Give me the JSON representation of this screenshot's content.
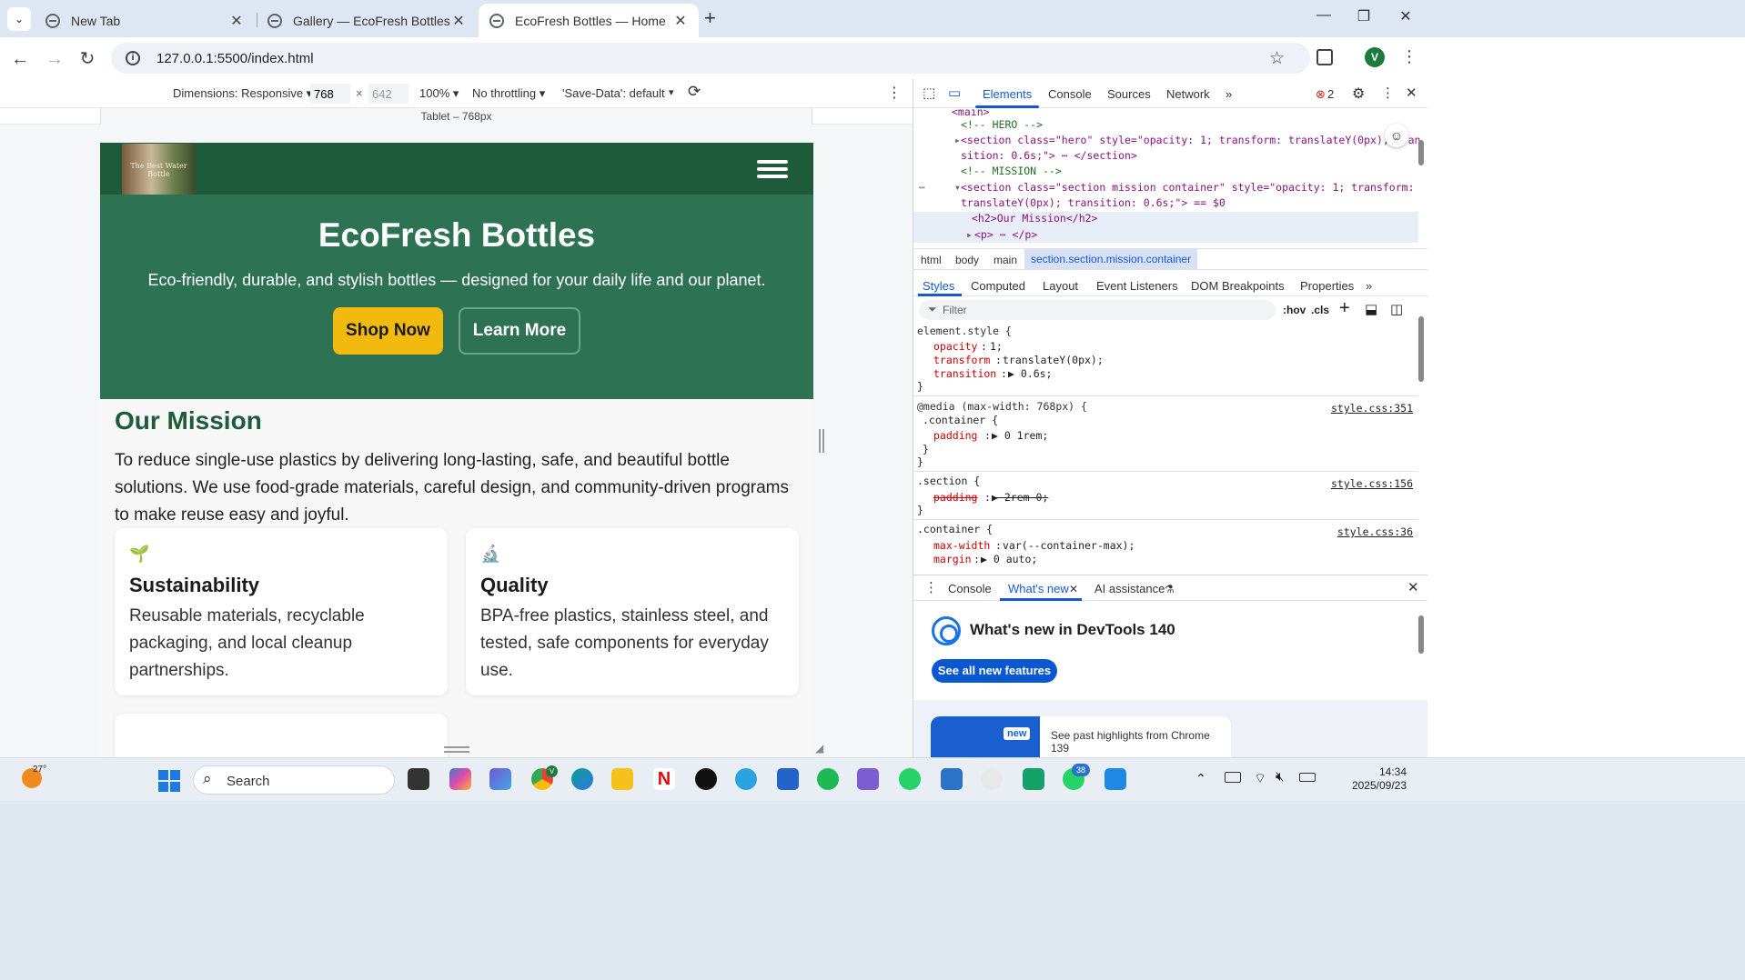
{
  "browser": {
    "tabs": [
      {
        "title": "New Tab"
      },
      {
        "title": "Gallery — EcoFresh Bottles"
      },
      {
        "title": "EcoFresh Bottles — Home"
      }
    ],
    "new_tab_symbol": "+",
    "url": "127.0.0.1:5500/index.html",
    "profile_initial": "V",
    "window_controls": {
      "minimize": "—",
      "restore": "❐",
      "close": "✕"
    }
  },
  "device_toolbar": {
    "dimensions_label": "Dimensions: Responsive ▾",
    "width": "768",
    "times": "×",
    "height": "642",
    "zoom": "100% ▾",
    "throttling": "No throttling ▾",
    "save_data": "'Save-Data': default",
    "media_query_label": "Tablet – 768px"
  },
  "site": {
    "logo_text": "The Best Water Bottle",
    "hero": {
      "title": "EcoFresh Bottles",
      "subtitle": "Eco-friendly, durable, and stylish bottles — designed for your daily life and our planet.",
      "primary_cta": "Shop Now",
      "secondary_cta": "Learn More"
    },
    "mission": {
      "heading": "Our Mission",
      "text": "To reduce single-use plastics by delivering long-lasting, safe, and beautiful bottle solutions. We use food-grade materials, careful design, and community-driven programs to make reuse easy and joyful."
    },
    "cards": [
      {
        "icon": "🌱",
        "title": "Sustainability",
        "text": "Reusable materials, recyclable packaging, and local cleanup partnerships."
      },
      {
        "icon": "🔬",
        "title": "Quality",
        "text": "BPA-free plastics, stainless steel, and tested, safe components for everyday use."
      }
    ]
  },
  "devtools": {
    "tabs": [
      "Elements",
      "Console",
      "Sources",
      "Network",
      "»"
    ],
    "error_count": "2",
    "dom_lines": {
      "main": "<main>",
      "hero_comment": "<!-- HERO -->",
      "hero_section_1": "<section class=\"hero\" style=\"opacity: 1; transform: translateY(0px); tran",
      "hero_section_2": "sition: 0.6s;\"> ⋯ </section>",
      "mission_comment": "<!-- MISSION -->",
      "mission_section_1": "<section class=\"section mission container\" style=\"opacity: 1; transform:",
      "mission_section_2": "translateY(0px); transition: 0.6s;\"> == $0",
      "h2": "<h2>Our Mission</h2>",
      "p": "<p> ⋯ </p>"
    },
    "breadcrumbs": [
      "html",
      "body",
      "main",
      "section.section.mission.container"
    ],
    "styles_tabs": [
      "Styles",
      "Computed",
      "Layout",
      "Event Listeners",
      "DOM Breakpoints",
      "Properties",
      "»"
    ],
    "filter_placeholder": "Filter",
    "hov": ":hov",
    "cls": ".cls",
    "rules": {
      "element_style": "element.style {",
      "opacity": "opacity",
      "opacity_val": "1;",
      "transform": "transform",
      "transform_val": "translateY(0px);",
      "transition": "transition",
      "transition_val": "▶ 0.6s;",
      "close": "}",
      "media": "@media (max-width: 768px) {",
      "container_sel": ".container {",
      "padding": "padding",
      "padding_val": "▶ 0 1rem;",
      "src1": "style.css:351",
      "section_sel": ".section {",
      "section_padding_val": "▶ 2rem 0;",
      "src2": "style.css:156",
      "container2_sel": ".container {",
      "maxwidth": "max-width",
      "maxwidth_val": "var(--container-max);",
      "margin": "margin",
      "margin_val": "▶ 0 auto;",
      "src3": "style.css:36"
    },
    "drawer": {
      "tabs": [
        "Console",
        "What's new",
        "AI assistance"
      ],
      "whats_new_title": "What's new in DevTools 140",
      "see_all": "See all new features",
      "new_badge": "new",
      "highlights": "See past highlights from Chrome 139"
    }
  },
  "taskbar": {
    "weather": "27°",
    "search": "Search",
    "chrome_badge": "V",
    "whatsapp_badge": "38",
    "time": "14:34",
    "date": "2025/09/23"
  }
}
